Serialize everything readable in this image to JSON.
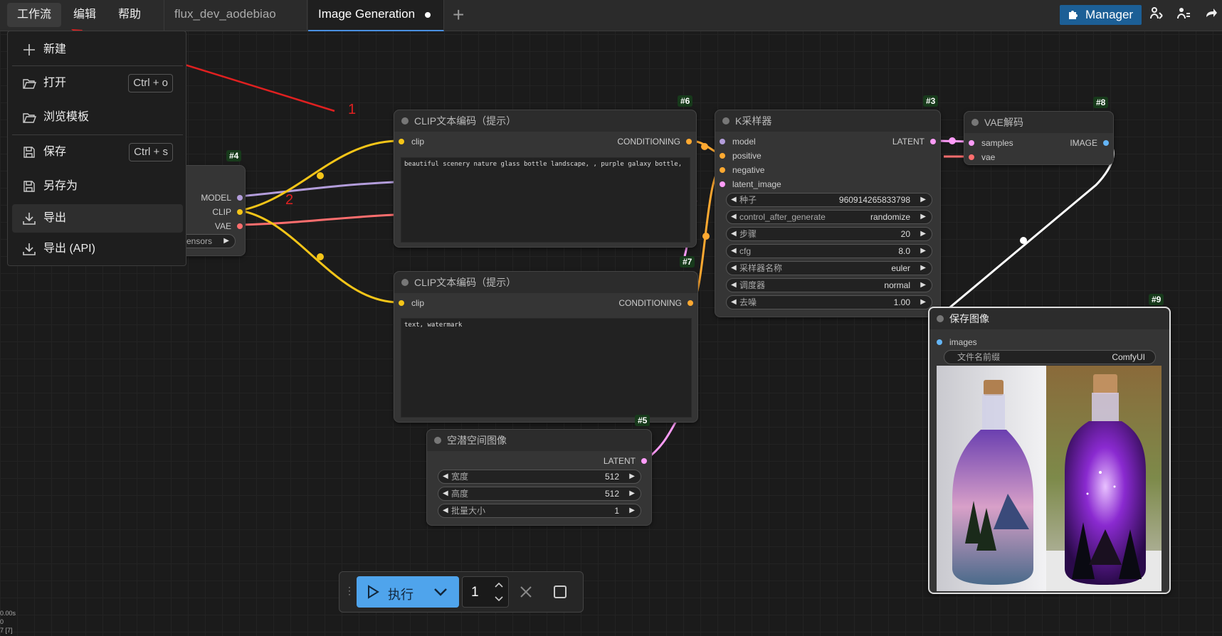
{
  "menu": {
    "workflow": "工作流",
    "edit": "编辑",
    "help": "帮助"
  },
  "tabs": [
    {
      "label": "flux_dev_aodebiao"
    },
    {
      "label": "Image Generation"
    }
  ],
  "toolbar": {
    "manager": "Manager"
  },
  "dropdown": {
    "items": [
      {
        "label": "新建",
        "shortcut": ""
      },
      {
        "label": "打开",
        "shortcut": "Ctrl + o"
      },
      {
        "label": "浏览模板",
        "shortcut": ""
      },
      {
        "label": "保存",
        "shortcut": "Ctrl + s"
      },
      {
        "label": "另存为",
        "shortcut": ""
      },
      {
        "label": "导出",
        "shortcut": ""
      },
      {
        "label": "导出 (API)",
        "shortcut": ""
      }
    ]
  },
  "annotations": {
    "arrow1": "1",
    "arrow2": "2"
  },
  "nodes": {
    "n4": {
      "id": "#4",
      "outputs": [
        "MODEL",
        "CLIP",
        "VAE"
      ],
      "widget_fragment": "ensors"
    },
    "n6": {
      "id": "#6",
      "title": "CLIP文本编码（提示）",
      "input": "clip",
      "output": "CONDITIONING",
      "text": "beautiful scenery nature glass bottle landscape, , purple galaxy bottle,"
    },
    "n7": {
      "id": "#7",
      "title": "CLIP文本编码（提示）",
      "input": "clip",
      "output": "CONDITIONING",
      "text": "text, watermark"
    },
    "n3": {
      "id": "#3",
      "title": "K采样器",
      "inputs": [
        "model",
        "positive",
        "negative",
        "latent_image"
      ],
      "output": "LATENT",
      "widgets": [
        {
          "label": "种子",
          "value": "960914265833798"
        },
        {
          "label": "control_after_generate",
          "value": "randomize"
        },
        {
          "label": "步骤",
          "value": "20"
        },
        {
          "label": "cfg",
          "value": "8.0"
        },
        {
          "label": "采样器名称",
          "value": "euler"
        },
        {
          "label": "调度器",
          "value": "normal"
        },
        {
          "label": "去噪",
          "value": "1.00"
        }
      ]
    },
    "n8": {
      "id": "#8",
      "title": "VAE解码",
      "inputs": [
        "samples",
        "vae"
      ],
      "output": "IMAGE"
    },
    "n9": {
      "id": "#9",
      "title": "保存图像",
      "input": "images",
      "widget": {
        "label": "文件名前缀",
        "value": "ComfyUI"
      }
    },
    "n5": {
      "id": "#5",
      "title": "空潜空间图像",
      "output": "LATENT",
      "widgets": [
        {
          "label": "宽度",
          "value": "512"
        },
        {
          "label": "高度",
          "value": "512"
        },
        {
          "label": "批量大小",
          "value": "1"
        }
      ]
    }
  },
  "queue": {
    "run_label": "执行",
    "count": "1"
  },
  "stats": {
    "line1": "0.00s",
    "line2": "0",
    "line3": "7 [7]"
  },
  "colors": {
    "accent": "#4fa4ec",
    "manager": "#1c5f96",
    "clip_wire": "#f5c518",
    "model_wire": "#b39ddb",
    "vae_wire": "#ff6e6e",
    "latent_wire": "#ff9cf9",
    "conditioning_wire": "#ffa931",
    "image_wire": "#ffffff",
    "annotation": "#e02020"
  }
}
